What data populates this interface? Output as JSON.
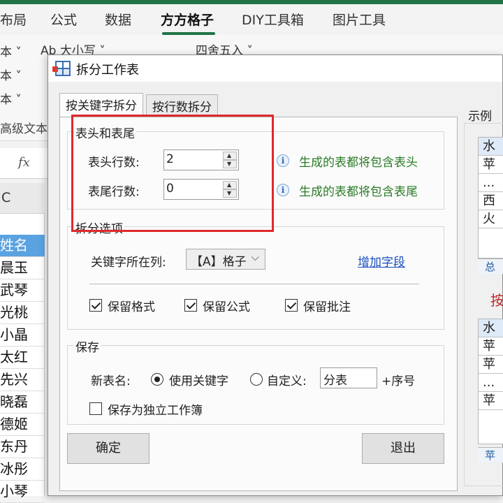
{
  "ribbon": {
    "tabs": [
      "布局",
      "公式",
      "数据",
      "方方格子",
      "DIY工具箱",
      "图片工具"
    ],
    "active_tab": "方方格子",
    "row_items": [
      "本 ˅",
      "本 ˅",
      "本 ˅"
    ],
    "ab_item": "Ab 大小写 ˅",
    "round_item": "四舍五入 ˅",
    "group_label": "高级文本"
  },
  "formula_bar": {
    "fx": "fx"
  },
  "sheet": {
    "column_header": "C",
    "cells": [
      "姓名",
      "晨玉",
      "武琴",
      "光桃",
      "小晶",
      "太红",
      "先兴",
      "晓磊",
      "德姬",
      "东丹",
      "冰彤",
      "小琴"
    ]
  },
  "dialog": {
    "title": "拆分工作表",
    "tabs": [
      "按关键字拆分",
      "按行数拆分"
    ],
    "header_footer": {
      "title": "表头和表尾",
      "header_rows_label": "表头行数:",
      "header_rows_value": "2",
      "footer_rows_label": "表尾行数:",
      "footer_rows_value": "0",
      "header_hint": "生成的表都将包含表头",
      "footer_hint": "生成的表都将包含表尾"
    },
    "split_options": {
      "title": "拆分选项",
      "key_column_label": "关键字所在列:",
      "key_column_value": "【A】格子",
      "add_field_link": "增加字段",
      "keep_format": "保留格式",
      "keep_formula": "保留公式",
      "keep_comment": "保留批注"
    },
    "save": {
      "title": "保存",
      "new_name_label": "新表名:",
      "use_keyword": "使用关键字",
      "custom": "自定义:",
      "custom_value": "分表",
      "suffix": "+序号",
      "save_independent": "保存为独立工作簿"
    },
    "ok_button": "确定",
    "exit_button": "退出",
    "example": {
      "label": "示例",
      "table1": [
        "水",
        "苹",
        "...",
        "西",
        "火"
      ],
      "tab1": "总",
      "arrow_text": "按",
      "table2": [
        "水",
        "苹",
        "苹",
        "...",
        "苹"
      ],
      "tab2": "苹"
    }
  }
}
